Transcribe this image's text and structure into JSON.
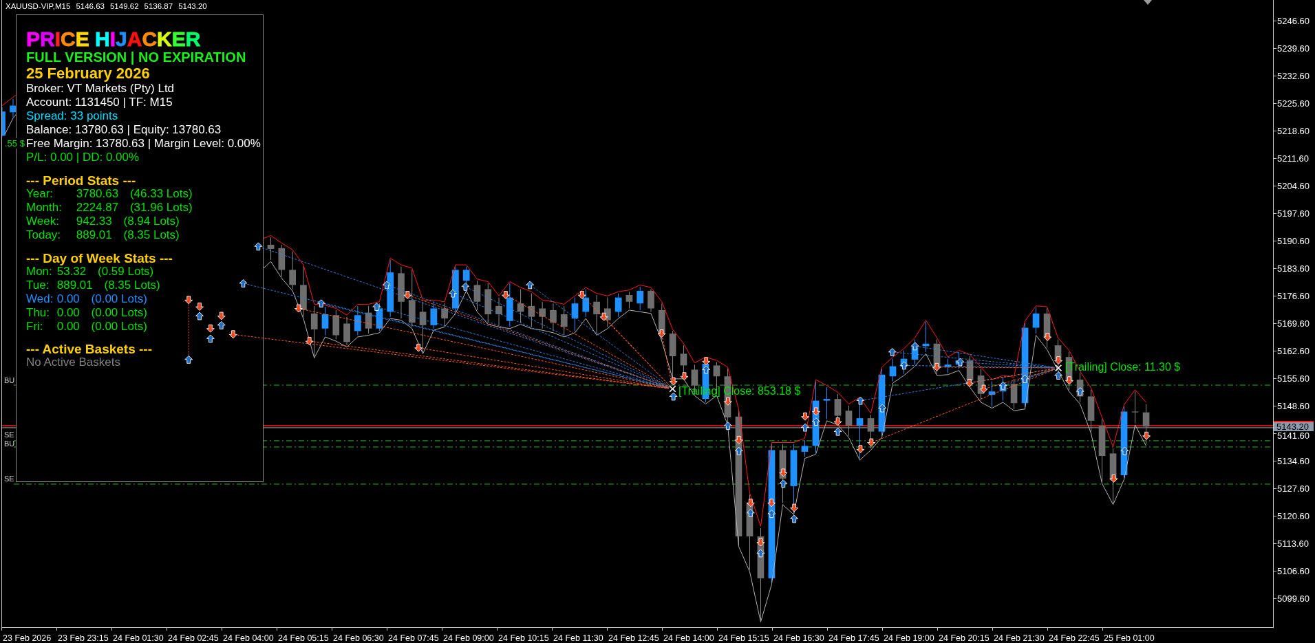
{
  "chart_header": {
    "symbol": "XAUUSD-VIP,M15",
    "prices": [
      "5146.63",
      "5149.62",
      "5136.87",
      "5143.20"
    ]
  },
  "info_panel": {
    "title": "PRICE HIJACKER",
    "subtitle": "FULL VERSION | NO EXPIRATION",
    "date": "25 February 2026",
    "account_lines": [
      {
        "text": "Broker: VT Markets (Pty) Ltd",
        "kind": "info"
      },
      {
        "text": "Account: 1131450 | TF: M15",
        "kind": "info"
      },
      {
        "text": "Spread: 33 points",
        "kind": "spread"
      },
      {
        "text": "Balance: 13780.63 | Equity: 13780.63",
        "kind": "info"
      },
      {
        "text": "Free Margin: 13780.63 | Margin Level: 0.00%",
        "kind": "info"
      },
      {
        "text": "P/L: 0.00 | DD: 0.00%",
        "kind": "profit"
      }
    ],
    "period_stats": {
      "heading": "--- Period Stats ---",
      "rows": [
        {
          "label": "Year:",
          "value": "3780.63",
          "lots": "(46.33 Lots)"
        },
        {
          "label": "Month:",
          "value": "2224.87",
          "lots": "(31.96 Lots)"
        },
        {
          "label": "Week:",
          "value": "942.33",
          "lots": "(8.94 Lots)"
        },
        {
          "label": "Today:",
          "value": "889.01",
          "lots": "(8.35 Lots)"
        }
      ]
    },
    "day_of_week_stats": {
      "heading": "--- Day of Week Stats ---",
      "rows": [
        {
          "label": "Mon:",
          "value": "53.32",
          "lots": "(0.59 Lots)",
          "current": false
        },
        {
          "label": "Tue:",
          "value": "889.01",
          "lots": "(8.35 Lots)",
          "current": false
        },
        {
          "label": "Wed:",
          "value": "0.00",
          "lots": "(0.00 Lots)",
          "current": true
        },
        {
          "label": "Thu:",
          "value": "0.00",
          "lots": "(0.00 Lots)",
          "current": false
        },
        {
          "label": "Fri:",
          "value": "0.00",
          "lots": "(0.00 Lots)",
          "current": false
        }
      ]
    },
    "active_baskets": {
      "heading": "--- Active Baskets ---",
      "empty_text": "No Active Baskets"
    }
  },
  "chart_labels": [
    {
      "text": ".55 $",
      "kind": "trailing"
    },
    {
      "text": "BU",
      "kind": "level"
    },
    {
      "text": "SE",
      "kind": "level"
    },
    {
      "text": "BU",
      "kind": "level"
    },
    {
      "text": "SE",
      "kind": "level"
    },
    {
      "text": "[Trailing] Close: 853.18 $",
      "kind": "trailing"
    },
    {
      "text": "[Trailing] Close: 11.30 $",
      "kind": "trailing"
    }
  ],
  "price_axis": {
    "labels": [
      "5246.60",
      "5239.60",
      "5232.60",
      "5225.60",
      "5218.60",
      "5211.60",
      "5204.60",
      "5197.60",
      "5190.60",
      "5183.60",
      "5176.60",
      "5169.60",
      "5162.60",
      "5155.60",
      "5148.60",
      "5141.60",
      "5134.60",
      "5127.60",
      "5120.60",
      "5113.60",
      "5106.60",
      "5099.60"
    ],
    "current_price": "5143.20"
  },
  "time_axis": {
    "labels": [
      "23 Feb 2026",
      "23 Feb 23:15",
      "24 Feb 01:30",
      "24 Feb 02:45",
      "24 Feb 04:00",
      "24 Feb 05:15",
      "24 Feb 06:30",
      "24 Feb 07:45",
      "24 Feb 09:00",
      "24 Feb 10:15",
      "24 Feb 11:30",
      "24 Feb 12:45",
      "24 Feb 14:00",
      "24 Feb 15:15",
      "24 Feb 16:30",
      "24 Feb 17:45",
      "24 Feb 19:00",
      "24 Feb 20:15",
      "24 Feb 21:30",
      "24 Feb 22:45",
      "25 Feb 01:00"
    ]
  }
}
